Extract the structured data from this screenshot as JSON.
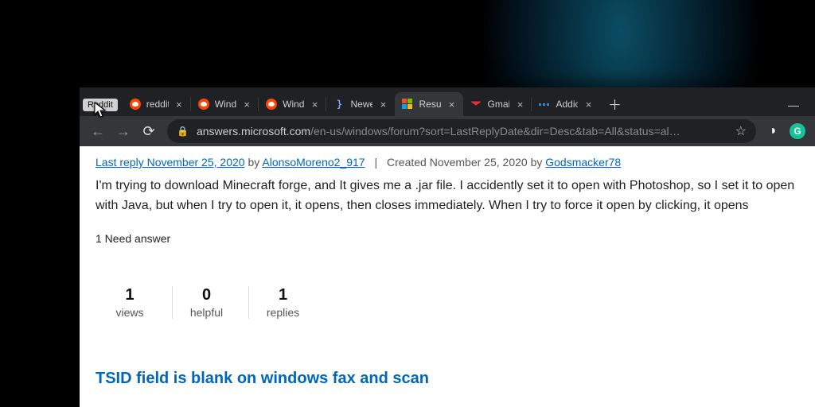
{
  "hover_tooltip": "Reddit",
  "tabs": [
    {
      "title": "reddit",
      "icon": "reddit"
    },
    {
      "title": "Wind",
      "icon": "reddit"
    },
    {
      "title": "Wind",
      "icon": "reddit"
    },
    {
      "title": "Newe",
      "icon": "brace"
    },
    {
      "title": "Result",
      "icon": "ms",
      "active": true
    },
    {
      "title": "Gmail",
      "icon": "gmail"
    },
    {
      "title": "Addic",
      "icon": "addic"
    }
  ],
  "url": {
    "host": "answers.microsoft.com",
    "path": "/en-us/windows/forum?sort=LastReplyDate&dir=Desc&tab=All&status=al…"
  },
  "post": {
    "last_reply_label": "Last reply November 25, 2020",
    "by1": "by",
    "author_reply": "AlonsoMoreno2_917",
    "created_label": "Created November 25, 2020 by",
    "author_created": "Godsmacker78",
    "body": "I'm trying to download Minecraft forge, and It gives me a .jar file. I accidently set it to open with Photoshop, so I set it to open with Java, but when I try to open it, it opens, then closes immediately. When I try to force it open by clicking, it opens",
    "need_answer": "1 Need answer",
    "stats": [
      {
        "num": "1",
        "lbl": "views"
      },
      {
        "num": "0",
        "lbl": "helpful"
      },
      {
        "num": "1",
        "lbl": "replies"
      }
    ],
    "next_title": "TSID field is blank on windows fax and scan"
  }
}
